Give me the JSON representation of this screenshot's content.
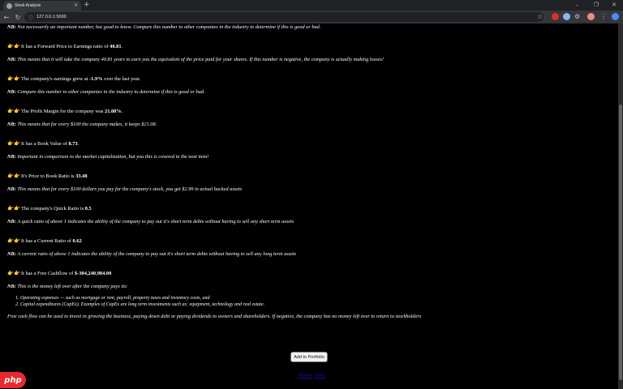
{
  "browser": {
    "tab_title": "Stock Analysis",
    "tab_close": "×",
    "new_tab": "+",
    "url": "127.0.0.1:5000",
    "window_controls": [
      "–",
      "❐",
      "✕"
    ]
  },
  "page": {
    "cut_line": "NB: Not necessarily an important number, but good to know. Compare this number to other companies in the industry to determine if this is good or bad.",
    "hands_icon": "👉👉",
    "metrics": [
      {
        "prefix": "It has a Forward Price to Earnings ratio of ",
        "value": "40.81",
        "suffix": ".",
        "nb_label": "NB:",
        "nb": " This means that it will take the company 40.81 years to earn you the equivalent of the price paid for your shares. If this number is negative, the company is actually making losses!"
      },
      {
        "prefix": "The company's earnings grew at ",
        "value": "-1.9%",
        "suffix": " over the last year.",
        "nb_label": "NB:",
        "nb": " Compare this number to other companies in the industry to determine if this is good or bad."
      },
      {
        "prefix": "The Profit Margin for the company was ",
        "value": "21.08%",
        "suffix": ".",
        "nb_label": "NB:",
        "nb": " This means that for every $100 the company makes, it keeps $21.08."
      },
      {
        "prefix": "It has a Book Value of ",
        "value": "8.73",
        "suffix": ".",
        "nb_label": "NB:",
        "nb": " Important in comparison to the market capitalization, but you this is covered in the next item!"
      },
      {
        "prefix": "It's Price to Book Ratio is ",
        "value": "33.48",
        "suffix": "",
        "nb_label": "NB:",
        "nb": " This means that for every $100 dollars you pay for the company's stock, you get $2.99 in actual backed assets"
      },
      {
        "prefix": "The company's Quick Ratio is ",
        "value": "0.5",
        "suffix": "",
        "nb_label": "NB:",
        "nb": " A quick ratio of above 1 indicates the ability of the company to pay out it's short term debts without having to sell any short term assets"
      },
      {
        "prefix": "It has a Current Ratio of ",
        "value": "0.62",
        "suffix": "",
        "nb_label": "NB:",
        "nb": " A current ratio of above 1 indicates the ability of the company to pay out it's short term debts without having to sell any long term assets"
      },
      {
        "prefix": "It has a Free Cashflow of ",
        "value": "$-304,240,984.00",
        "suffix": "",
        "nb_label": "NB:",
        "nb": " This is the money left over after the company pays its:"
      }
    ],
    "cashflow_items": [
      "Operating expenses — such as mortgage or rent, payroll, property taxes and inventory costs, and",
      "Capital expenditures (CapEx). Examples of CapEx are long term investments such as: equipment, technology and real estate."
    ],
    "cashflow_note": "Free cash flow can be used to invest in growing the business, paying down debt or paying dividends to owners and shareholders. If negative, the company has no money left over to return to stockholders",
    "add_button": "Add to Portfolio",
    "pager_links": [
      "Home",
      "Next"
    ]
  },
  "badge": "php"
}
